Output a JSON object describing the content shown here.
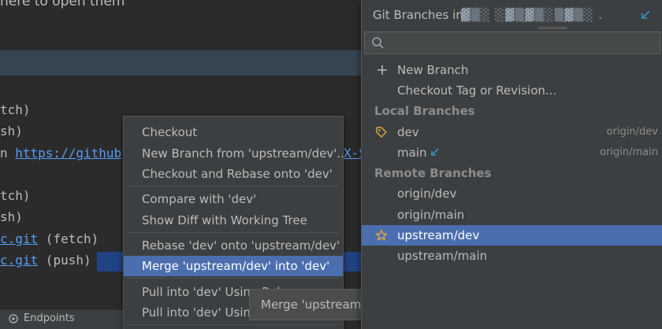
{
  "background": {
    "hint_text": "here to open them",
    "terminal_lines": [
      {
        "text": "tch)"
      },
      {
        "text": "sh)"
      },
      {
        "prefix": "n ",
        "link": "https://github"
      },
      {
        "text": ""
      },
      {
        "text": "tch)"
      },
      {
        "text": "sh)"
      },
      {
        "link": "c.git",
        "suffix": " (fetch)"
      },
      {
        "link": "c.git",
        "suffix": " (push)"
      }
    ],
    "right_fragment": "X-S"
  },
  "status_bar": {
    "endpoints_label": "Endpoints"
  },
  "context_menu": {
    "items": [
      {
        "label": "Checkout"
      },
      {
        "label": "New Branch from 'upstream/dev'..."
      },
      {
        "label": "Checkout and Rebase onto 'dev'"
      },
      {
        "label": "Compare with 'dev'"
      },
      {
        "label": "Show Diff with Working Tree"
      },
      {
        "label": "Rebase 'dev' onto 'upstream/dev'"
      },
      {
        "label": "Merge 'upstream/dev' into 'dev'"
      },
      {
        "label": "Pull into 'dev' Using Rebase"
      },
      {
        "label": "Pull into 'dev' Using Merge"
      }
    ],
    "selected_index": 6
  },
  "tooltip": {
    "text": "Merge 'upstream/dev' into 'dev'"
  },
  "git_popup": {
    "title": "Git Branches in",
    "repo_name": "▓▒░  ░▓▒▓▒░▒▓▒░ .",
    "search": {
      "value": "",
      "placeholder": ""
    },
    "actions": [
      {
        "label": "New Branch",
        "icon": "plus-icon"
      },
      {
        "label": "Checkout Tag or Revision...",
        "icon": ""
      }
    ],
    "local_header": "Local Branches",
    "local_branches": [
      {
        "name": "dev",
        "tracking": "origin/dev",
        "icon": "tag-icon",
        "current": false
      },
      {
        "name": "main",
        "tracking": "origin/main",
        "icon": "",
        "current": true
      }
    ],
    "remote_header": "Remote Branches",
    "remote_branches": [
      {
        "name": "origin/dev",
        "icon": ""
      },
      {
        "name": "origin/main",
        "icon": ""
      },
      {
        "name": "upstream/dev",
        "icon": "star-icon",
        "selected": true
      },
      {
        "name": "upstream/main",
        "icon": ""
      }
    ],
    "colors": {
      "selection": "#4b6eaf",
      "tag_icon": "#d9a343",
      "star_icon": "#e8a33d",
      "current_arrow": "#3592c4"
    }
  }
}
